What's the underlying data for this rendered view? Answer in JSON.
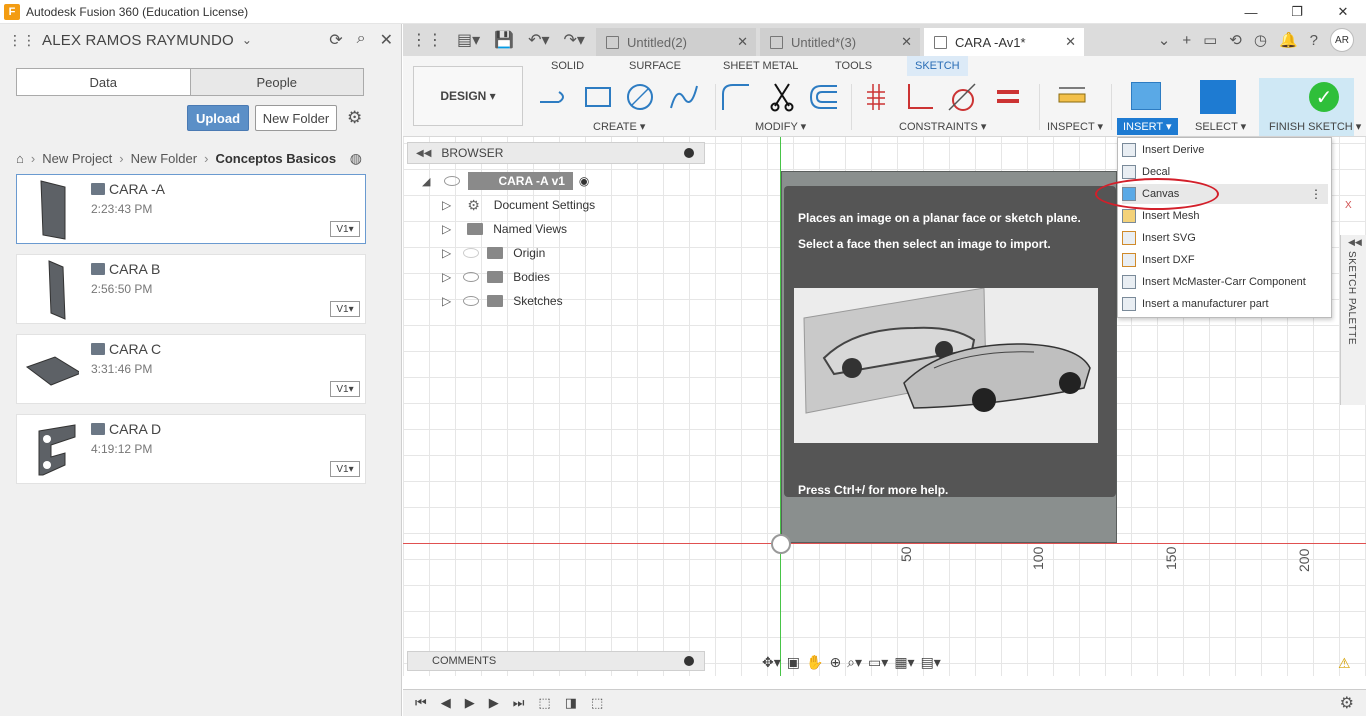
{
  "window": {
    "title": "Autodesk Fusion 360 (Education License)"
  },
  "data_panel": {
    "user": "ALEX RAMOS RAYMUNDO",
    "tabs": [
      "Data",
      "People"
    ],
    "upload_label": "Upload",
    "new_folder_label": "New Folder",
    "breadcrumb": [
      "New Project",
      "New Folder",
      "Conceptos Basicos"
    ],
    "files": [
      {
        "name": "CARA -A",
        "time": "2:23:43 PM",
        "version": "V1▾"
      },
      {
        "name": "CARA B",
        "time": "2:56:50 PM",
        "version": "V1▾"
      },
      {
        "name": "CARA C",
        "time": "3:31:46 PM",
        "version": "V1▾"
      },
      {
        "name": "CARA D",
        "time": "4:19:12 PM",
        "version": "V1▾"
      }
    ]
  },
  "doc_tabs": [
    {
      "label": "Untitled(2)"
    },
    {
      "label": "Untitled*(3)"
    },
    {
      "label": "CARA -Av1*"
    }
  ],
  "user_initials": "AR",
  "toolbar": {
    "workspace": "DESIGN ▾",
    "tabs": [
      "SOLID",
      "SURFACE",
      "SHEET METAL",
      "TOOLS",
      "SKETCH"
    ],
    "groups": {
      "create": "CREATE ▾",
      "modify": "MODIFY ▾",
      "constraints": "CONSTRAINTS ▾",
      "inspect": "INSPECT ▾",
      "insert": "INSERT ▾",
      "select": "SELECT ▾",
      "finish": "FINISH SKETCH ▾"
    }
  },
  "browser": {
    "title": "BROWSER",
    "root": "CARA -A v1",
    "items": [
      "Document Settings",
      "Named Views",
      "Origin",
      "Bodies",
      "Sketches"
    ]
  },
  "tooltip": {
    "line1": "Places an image on a planar face or sketch plane.",
    "line2": "Select a face then select an image to import.",
    "help": "Press Ctrl+/ for more help."
  },
  "insert_menu": {
    "items": [
      "Insert Derive",
      "Decal",
      "Canvas",
      "Insert Mesh",
      "Insert SVG",
      "Insert DXF",
      "Insert McMaster-Carr Component",
      "Insert a manufacturer part"
    ],
    "highlighted": "Canvas"
  },
  "sketch_palette": "SKETCH PALETTE",
  "axis_labels": [
    "50",
    "100",
    "150",
    "200"
  ],
  "axis_x": "X",
  "comments": "COMMENTS",
  "colors": {
    "accent": "#1e7bd2",
    "finish": "#2fbf3a",
    "highlight_ring": "#d31f2a"
  }
}
